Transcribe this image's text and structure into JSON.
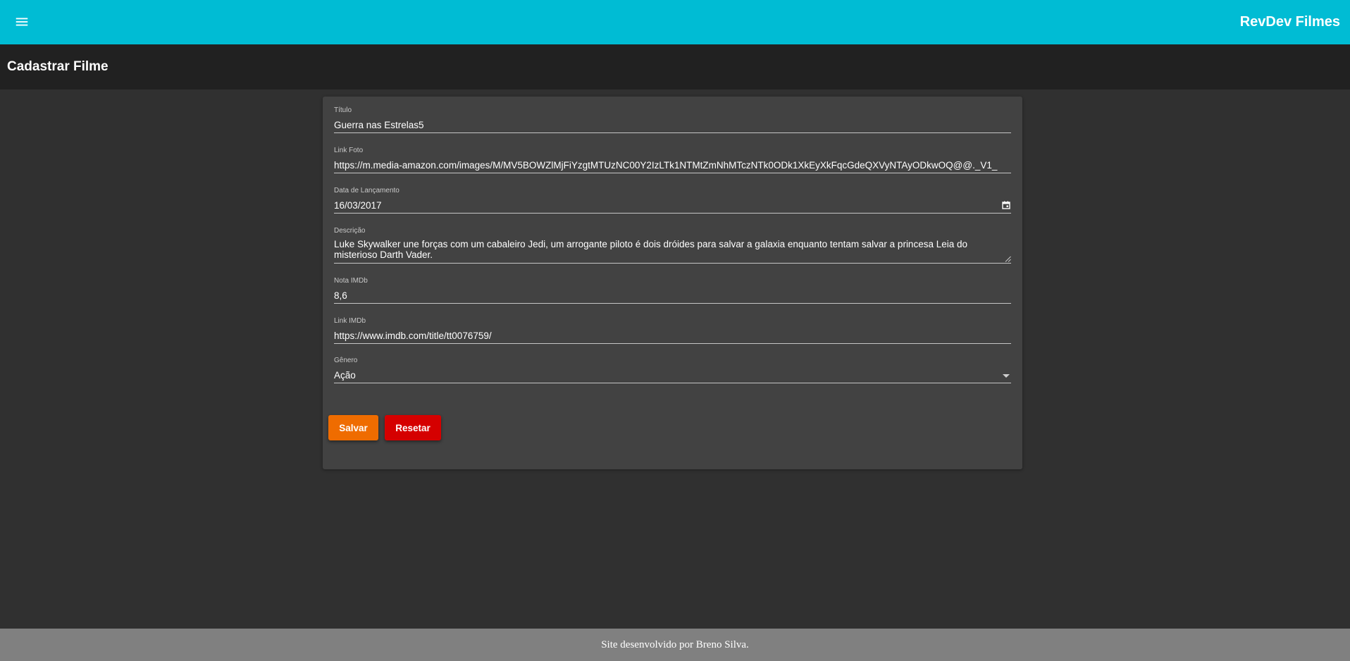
{
  "app": {
    "brand": "RevDev Filmes",
    "menu_icon": "menu-icon",
    "accent_color": "#00bcd4"
  },
  "page": {
    "title": "Cadastrar Filme"
  },
  "form": {
    "titulo": {
      "label": "Título",
      "value": "Guerra nas Estrelas5"
    },
    "link_foto": {
      "label": "Link Foto",
      "value": "https://m.media-amazon.com/images/M/MV5BOWZlMjFiYzgtMTUzNC00Y2IzLTk1NTMtZmNhMTczNTk0ODk1XkEyXkFqcGdeQXVyNTAyODkwOQ@@._V1_"
    },
    "data_lancamento": {
      "label": "Data de Lançamento",
      "value": "16/03/2017",
      "icon": "calendar-icon"
    },
    "descricao": {
      "label": "Descrição",
      "value": "Luke Skywalker une forças com um cabaleiro Jedi, um arrogante piloto é dois dróides para salvar a galaxia enquanto tentam salvar a princesa Leia do misterioso Darth Vader."
    },
    "nota_imdb": {
      "label": "Nota IMDb",
      "value": "8,6"
    },
    "link_imdb": {
      "label": "Link IMDb",
      "value": "https://www.imdb.com/title/tt0076759/"
    },
    "genero": {
      "label": "Gênero",
      "value": "Ação",
      "icon": "dropdown-arrow-icon"
    }
  },
  "buttons": {
    "save_label": "Salvar",
    "save_color": "#ef6c00",
    "reset_label": "Resetar",
    "reset_color": "#d50000"
  },
  "footer": {
    "text": "Site desenvolvido por Breno Silva."
  }
}
